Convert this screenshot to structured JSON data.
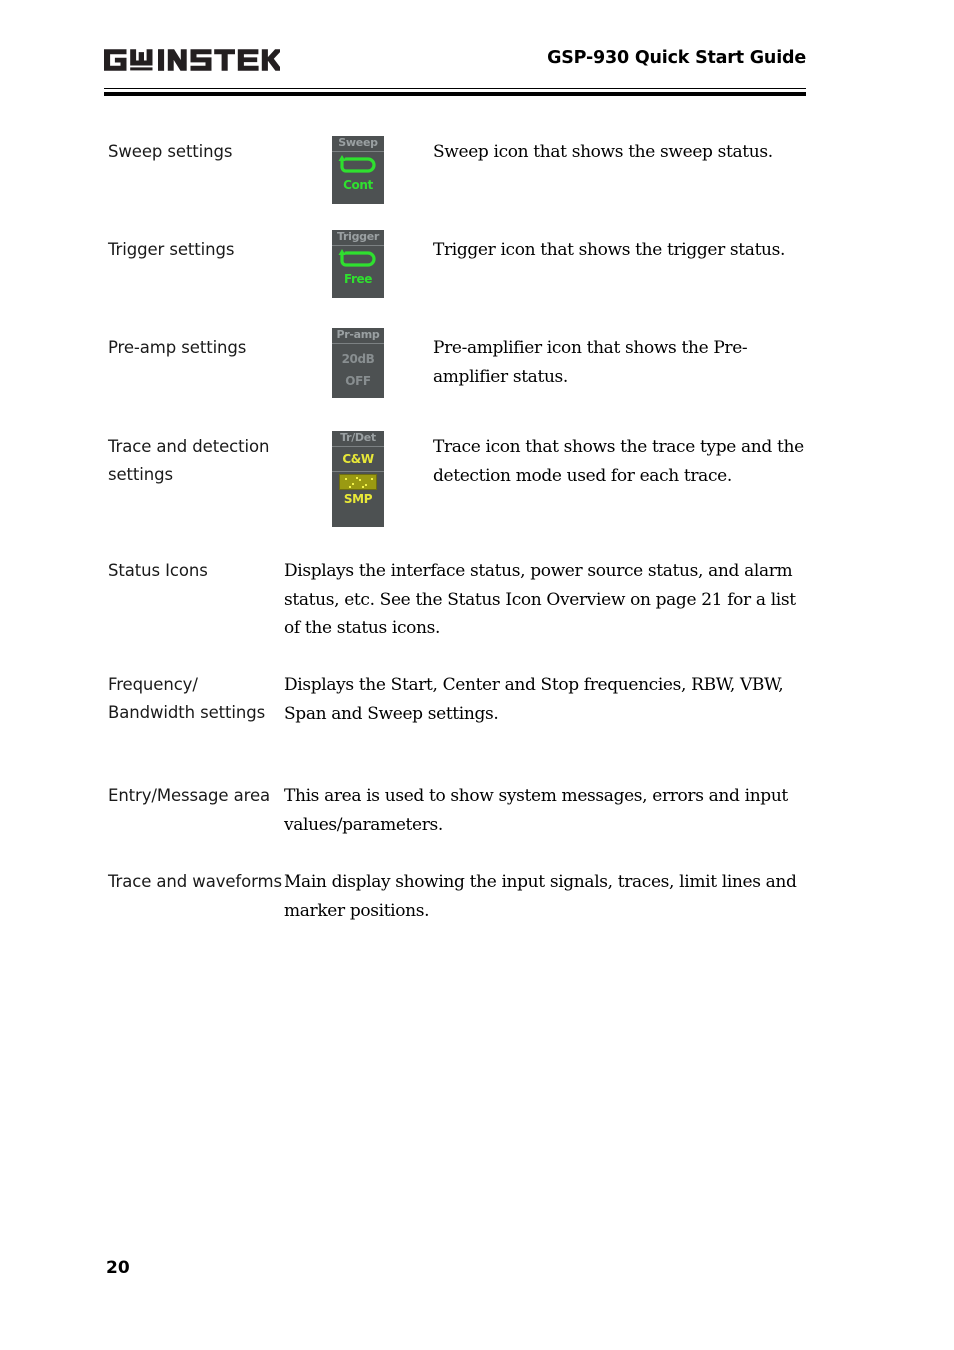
{
  "header": {
    "logo_text": "GW INSTEK",
    "title": "GSP-930 Quick Start Guide"
  },
  "rows": [
    {
      "label": "Sweep settings",
      "description": "Sweep icon that shows the sweep status.",
      "icon": {
        "name": "sweep-status-icon",
        "title": "Sweep",
        "value": "Cont",
        "glyph": "loop-arrow",
        "color": "#2fe02f"
      }
    },
    {
      "label": "Trigger settings",
      "description": "Trigger icon that shows the trigger status.",
      "icon": {
        "name": "trigger-status-icon",
        "title": "Trigger",
        "value": "Free",
        "glyph": "loop-arrow",
        "color": "#2fe02f"
      }
    },
    {
      "label": "Pre-amp settings",
      "description": "Pre-amplifier icon that shows the Pre-amplifier status.",
      "icon": {
        "name": "preamp-status-icon",
        "title": "Pr-amp",
        "line1": "20dB",
        "line2": "OFF",
        "color": "#888e90"
      }
    },
    {
      "label": "Trace and detection settings",
      "description": "Trace icon that shows the trace type and the detection mode used for each trace.",
      "icon": {
        "name": "trace-detection-icon",
        "title": "Tr/Det",
        "line1": "C&W",
        "line2": "SMP",
        "color": "#e8e838"
      }
    },
    {
      "label": "Status Icons",
      "description": "Displays the interface status, power source status, and alarm status, etc. See the Status Icon Overview on page 21 for a list of the status icons."
    },
    {
      "label": "Frequency/ Bandwidth settings",
      "description": "Displays the Start, Center and Stop frequencies, RBW, VBW, Span and Sweep settings."
    },
    {
      "label": "Entry/Message area",
      "description": "This area is used to show system messages, errors and input values/parameters."
    },
    {
      "label": "Trace and waveforms",
      "description": "Main display showing the input signals, traces, limit lines and marker positions."
    }
  ],
  "footer": {
    "page_number": "20"
  }
}
